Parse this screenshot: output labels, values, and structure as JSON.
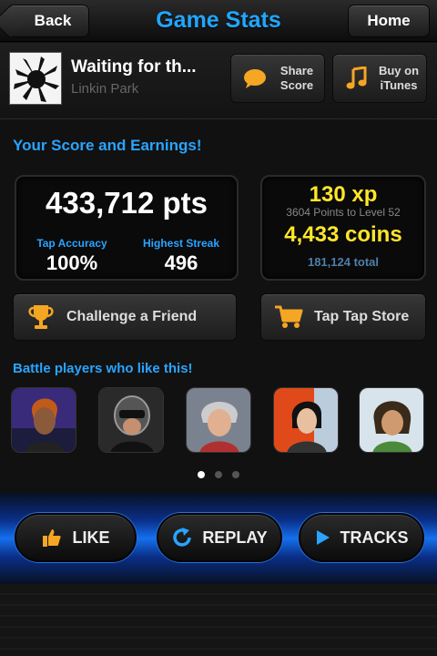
{
  "nav": {
    "back_label": "Back",
    "title": "Game Stats",
    "home_label": "Home"
  },
  "song": {
    "title": "Waiting for th...",
    "artist": "Linkin Park",
    "share_label_1": "Share",
    "share_label_2": "Score",
    "buy_label_1": "Buy on",
    "buy_label_2": "iTunes"
  },
  "score": {
    "heading": "Your Score and Earnings!",
    "points": "433,712 pts",
    "tap_accuracy_label": "Tap Accuracy",
    "tap_accuracy_value": "100%",
    "highest_streak_label": "Highest Streak",
    "highest_streak_value": "496",
    "xp": "130 xp",
    "xp_sub": "3604 Points to Level 52",
    "coins": "4,433 coins",
    "coins_total": "181,124 total"
  },
  "buttons": {
    "challenge_label": "Challenge a Friend",
    "store_label": "Tap Tap Store"
  },
  "battle": {
    "heading": "Battle players who like this!",
    "page_count": 3,
    "active_page": 1
  },
  "bottom": {
    "like_label": "LIKE",
    "replay_label": "REPLAY",
    "tracks_label": "TRACKS"
  },
  "colors": {
    "accent_blue": "#22a6ff",
    "highlight_yellow": "#ffe629",
    "icon_orange": "#f5a623"
  }
}
